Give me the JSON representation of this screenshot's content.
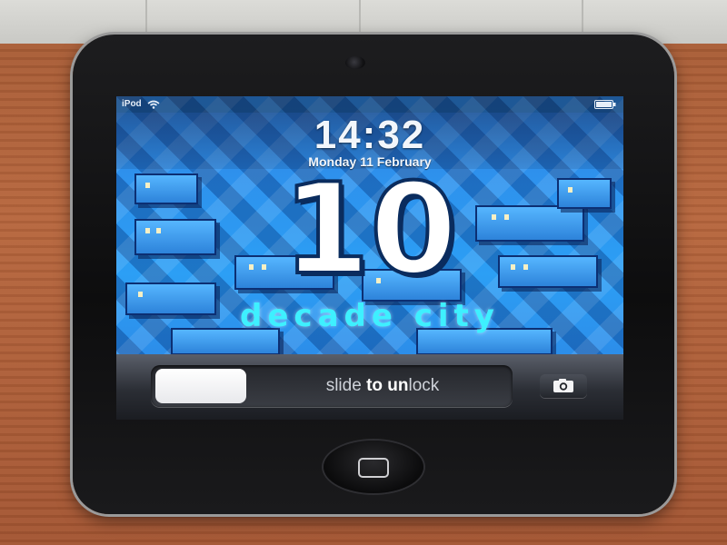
{
  "status_bar": {
    "carrier": "iPod",
    "wifi_icon": "wifi-icon",
    "battery_icon": "battery-icon"
  },
  "lock_screen": {
    "time": "14:32",
    "date": "Monday 11 February"
  },
  "wallpaper": {
    "number": "10",
    "caption": "decade city"
  },
  "unlock": {
    "label_prefix": "slide ",
    "label_bold_1": "to",
    "label_middle": " ",
    "label_bold_2": "un",
    "label_suffix": "lock",
    "camera_icon": "camera-icon"
  },
  "device": {
    "home_icon": "home-button-icon"
  },
  "colors": {
    "caption": "#3ef0ff",
    "sky": "#2c9ff5",
    "building_outline": "#0c2f73"
  }
}
